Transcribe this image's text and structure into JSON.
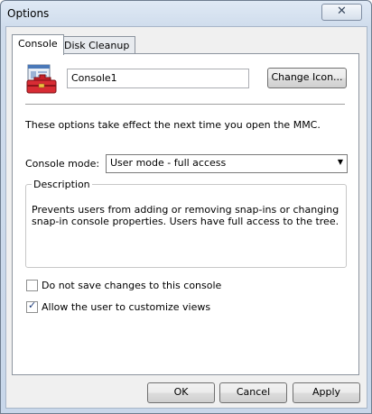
{
  "window": {
    "title": "Options",
    "close_glyph": "✕"
  },
  "tabs": [
    {
      "label": "Console",
      "active": true
    },
    {
      "label": "Disk Cleanup",
      "active": false
    }
  ],
  "console": {
    "icon": "console-toolbox-icon",
    "name": "Console1",
    "change_icon_label": "Change Icon..."
  },
  "info_text": "These options take effect the next time you open the MMC.",
  "mode": {
    "label": "Console mode:",
    "selected": "User mode - full access"
  },
  "description": {
    "title": "Description",
    "text": "Prevents users from adding or removing snap-ins or changing snap-in console properties. Users have full access to the tree."
  },
  "checkboxes": [
    {
      "label": "Do not save changes to this console",
      "checked": false
    },
    {
      "label": "Allow the user to customize views",
      "checked": true
    }
  ],
  "buttons": {
    "ok": "OK",
    "cancel": "Cancel",
    "apply": "Apply"
  }
}
